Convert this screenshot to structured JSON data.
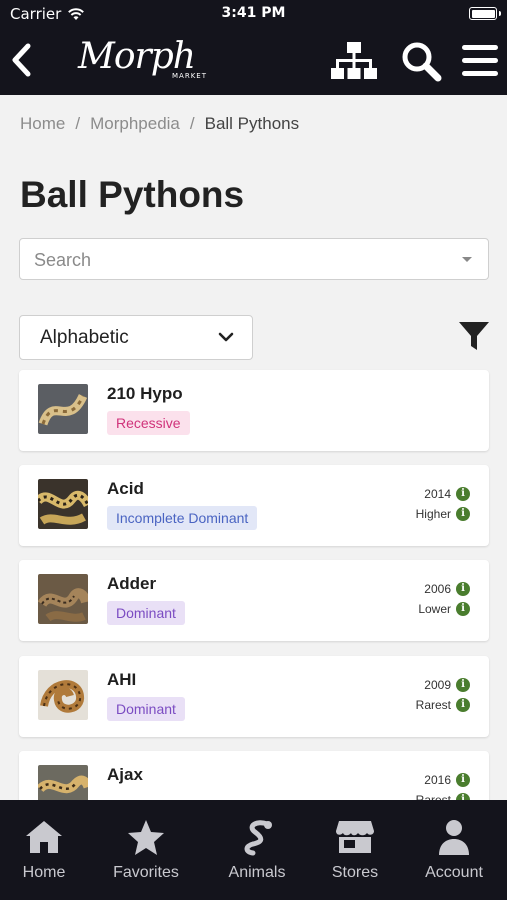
{
  "status_bar": {
    "carrier": "Carrier",
    "time": "3:41 PM"
  },
  "header": {
    "logo_text": "Morph",
    "logo_subtext": "MARKET"
  },
  "breadcrumb": [
    "Home",
    "Morphpedia",
    "Ball Pythons"
  ],
  "page_title": "Ball Pythons",
  "search": {
    "placeholder": "Search"
  },
  "sort": {
    "selected": "Alphabetic"
  },
  "traits": [
    {
      "name": "210 Hypo",
      "badge": "Recessive",
      "badge_type": "recessive",
      "year": "",
      "rarity": ""
    },
    {
      "name": "Acid",
      "badge": "Incomplete Dominant",
      "badge_type": "incomplete",
      "year": "2014",
      "rarity": "Higher"
    },
    {
      "name": "Adder",
      "badge": "Dominant",
      "badge_type": "dominant",
      "year": "2006",
      "rarity": "Lower"
    },
    {
      "name": "AHI",
      "badge": "Dominant",
      "badge_type": "dominant",
      "year": "2009",
      "rarity": "Rarest"
    },
    {
      "name": "Ajax",
      "badge": "",
      "badge_type": "incomplete",
      "year": "2016",
      "rarity": "Rarest"
    }
  ],
  "tabs": [
    {
      "label": "Home",
      "icon": "home-icon"
    },
    {
      "label": "Favorites",
      "icon": "star-icon"
    },
    {
      "label": "Animals",
      "icon": "snake-icon"
    },
    {
      "label": "Stores",
      "icon": "store-icon"
    },
    {
      "label": "Account",
      "icon": "person-icon"
    }
  ],
  "colors": {
    "dark_bar": "#14141c",
    "recessive_text": "#d0337b",
    "incomplete_text": "#4a64c2",
    "dominant_text": "#7b4cc2",
    "info_green": "#4a7d2e"
  }
}
